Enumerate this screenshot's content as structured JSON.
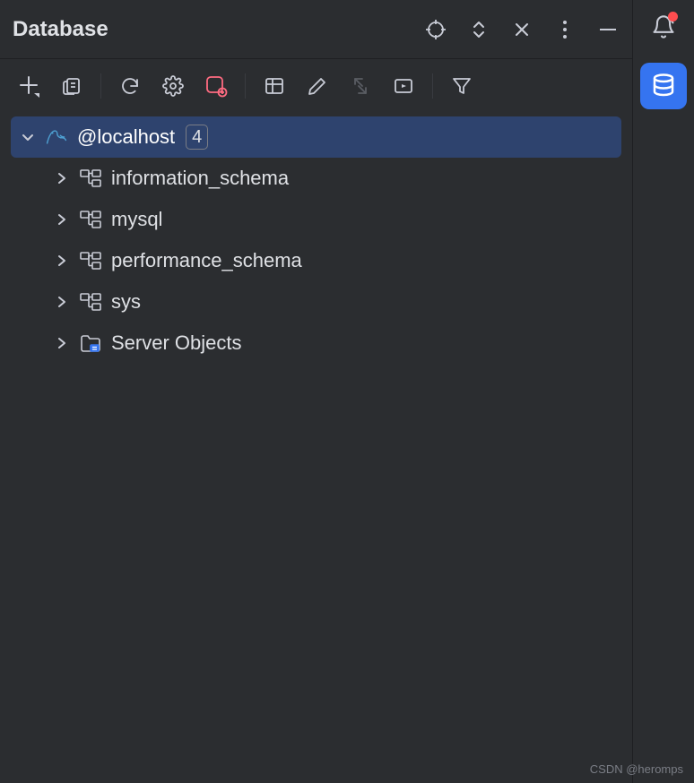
{
  "panel": {
    "title": "Database"
  },
  "connection": {
    "name": "@localhost",
    "badge": "4"
  },
  "schemas": [
    {
      "name": "information_schema",
      "icon": "schema"
    },
    {
      "name": "mysql",
      "icon": "schema"
    },
    {
      "name": "performance_schema",
      "icon": "schema"
    },
    {
      "name": "sys",
      "icon": "schema"
    },
    {
      "name": "Server Objects",
      "icon": "folder"
    }
  ],
  "watermark": "CSDN @heromps"
}
